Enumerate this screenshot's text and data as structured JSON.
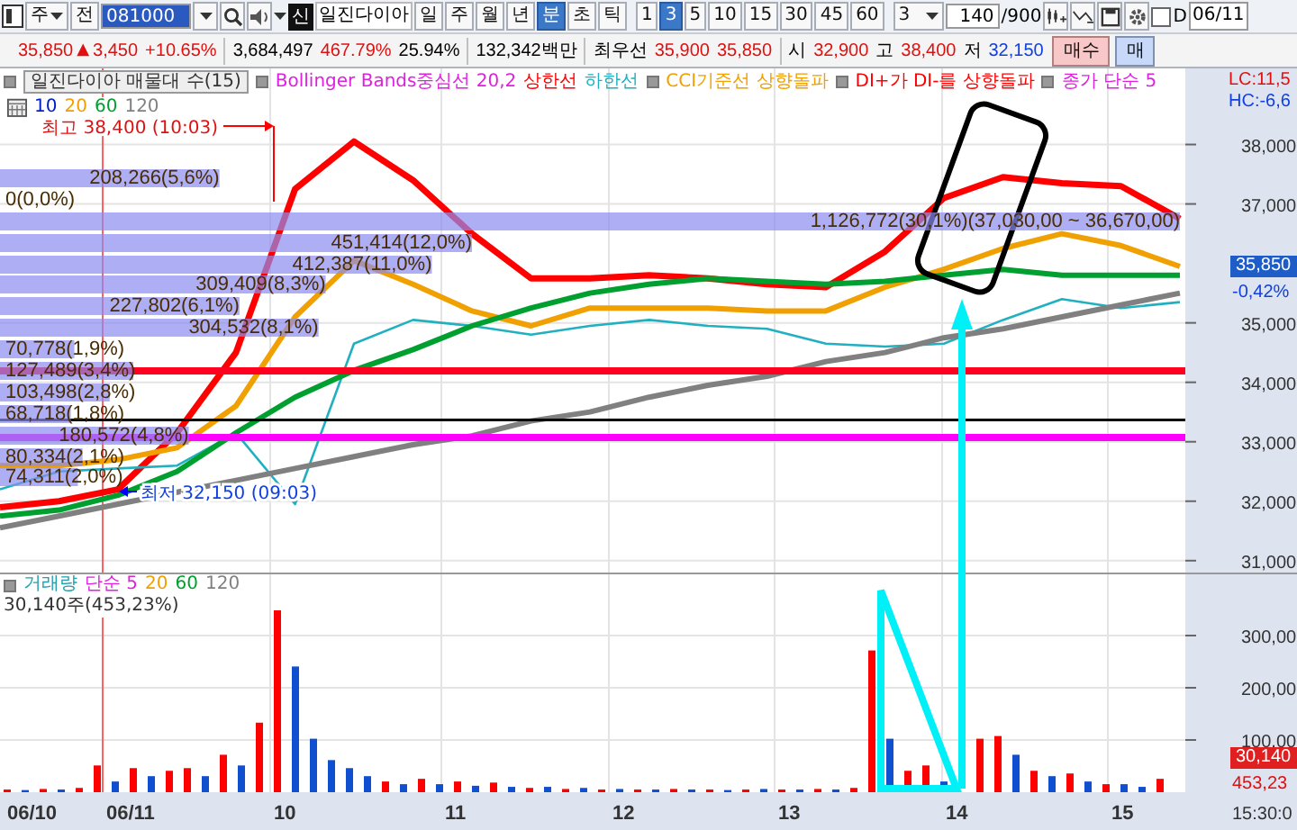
{
  "toolbar": {
    "market": "주",
    "prev": "전",
    "code": "081000",
    "badge": "신",
    "name": "일진다이아",
    "periods": [
      {
        "label": "일",
        "selected": false
      },
      {
        "label": "주",
        "selected": false
      },
      {
        "label": "월",
        "selected": false
      },
      {
        "label": "년",
        "selected": false
      },
      {
        "label": "분",
        "selected": true
      },
      {
        "label": "초",
        "selected": false
      },
      {
        "label": "틱",
        "selected": false
      }
    ],
    "intervals": [
      {
        "label": "1",
        "selected": false
      },
      {
        "label": "3",
        "selected": true
      },
      {
        "label": "5",
        "selected": false
      },
      {
        "label": "10",
        "selected": false
      },
      {
        "label": "15",
        "selected": false
      },
      {
        "label": "30",
        "selected": false
      },
      {
        "label": "45",
        "selected": false
      },
      {
        "label": "60",
        "selected": false
      }
    ],
    "interval_select": "3",
    "count": "140",
    "count_max": "/900",
    "option": {
      "label": "D",
      "checked": false
    },
    "date": "06/11"
  },
  "quote": {
    "price": "35,850",
    "direction": "▲",
    "change": "3,450",
    "change_pct": "+10.65%",
    "volume": "3,684,497",
    "volume_ratio": "467.79%",
    "turnover": "25.94%",
    "amount": "132,342백만",
    "best_label": "최우선",
    "best_ask": "35,900",
    "best_bid": "35,850",
    "open_label": "시",
    "open": "32,900",
    "high_label": "고",
    "high": "38,400",
    "low_label": "저",
    "low": "32,150",
    "buttons": [
      {
        "label": "매수",
        "kind": "buy"
      },
      {
        "label": "매",
        "kind": "sell"
      }
    ]
  },
  "chart": {
    "title": "일진다이아 매물대 수(15)",
    "legend": [
      {
        "label": "Bollinger Bands중심선 20,2",
        "color": "#e020e0",
        "marker": true
      },
      {
        "label": "상한선",
        "color": "#ff0000",
        "marker": false
      },
      {
        "label": "하한선",
        "color": "#20b0c0",
        "marker": false
      },
      {
        "label": "CCI기준선 상향돌파",
        "color": "#f0a000",
        "marker": true
      },
      {
        "label": "DI+가 DI-를 상향돌파",
        "color": "#ff0000",
        "marker": true
      },
      {
        "label": "종가 단순 5",
        "color": "#e020e0",
        "marker": true
      }
    ],
    "ma_legend": [
      {
        "label": "10",
        "color": "#0020c0"
      },
      {
        "label": "20",
        "color": "#f0a000"
      },
      {
        "label": "60",
        "color": "#00a030"
      },
      {
        "label": "120",
        "color": "#808080"
      }
    ],
    "axis": {
      "lc": "LC:11,5",
      "hc": "HC:-6,6",
      "current": "35,850",
      "current_pct": "-0,42%"
    },
    "high_label": "최고 38,400 (10:03)",
    "low_label": "최저 32,150 (09:03)",
    "volume_profile": [
      {
        "label": "208,266(5,6%)",
        "level": 0.186
      },
      {
        "label": "0(0,0%)"
      },
      {
        "label": "1,126,772(30,1%)(37,030,00 ~ 36,670,00)",
        "level": 1
      },
      {
        "label": "451,414(12,0%)",
        "level": 0.4
      },
      {
        "label": "412,387(11,0%)",
        "level": 0.366
      },
      {
        "label": "309,409(8,3%)",
        "level": 0.276
      },
      {
        "label": "227,802(6,1%)",
        "level": 0.203
      },
      {
        "label": "304,532(8,1%)",
        "level": 0.27
      },
      {
        "label": "70,778(1,9%)",
        "level": 0.063
      },
      {
        "label": "127,489(3,4%)",
        "level": 0.113
      },
      {
        "label": "103,498(2,8%)",
        "level": 0.093
      },
      {
        "label": "68,718(1,8%)",
        "level": 0.06
      },
      {
        "label": "180,572(4,8%)",
        "level": 0.16
      },
      {
        "label": "80,334(2,1%)",
        "level": 0.07
      },
      {
        "label": "74,311(2,0%)",
        "level": 0.066
      }
    ],
    "chart_data": {
      "type": "line",
      "categories": [
        null,
        null,
        null,
        null,
        null,
        null,
        null,
        null,
        null,
        null,
        null,
        null,
        null,
        null,
        null,
        null,
        null,
        null,
        null,
        null,
        null
      ],
      "ylim": [
        30800,
        39280
      ],
      "grid": true,
      "yticks": [
        {
          "value": 38000,
          "label": "38,000"
        },
        {
          "value": 37000,
          "label": "37,000"
        },
        {
          "value": 35000,
          "label": "35,000"
        },
        {
          "value": 34000,
          "label": "34,000"
        },
        {
          "value": 33000,
          "label": "33,000"
        },
        {
          "value": 32000,
          "label": "32,000"
        },
        {
          "value": 31000,
          "label": "31,000"
        }
      ],
      "series": [
        {
          "color": "#ff0000",
          "values": [
            31900,
            32000,
            32200,
            33150,
            34500,
            37250,
            38050,
            37400,
            36500,
            35750,
            35750,
            35800,
            35750,
            35650,
            35600,
            36200,
            37100,
            37450,
            37350,
            37300,
            36750
          ]
        },
        {
          "color": "#20b0c0",
          "values": [
            32200,
            32500,
            32550,
            32600,
            33150,
            31950,
            34650,
            35050,
            34950,
            34800,
            34950,
            35050,
            34950,
            34900,
            34650,
            34600,
            34650,
            35050,
            35400,
            35250,
            35350
          ]
        },
        {
          "color": "#f0a000",
          "values": [
            32600,
            32600,
            32700,
            32900,
            33600,
            35100,
            36050,
            35650,
            35200,
            34950,
            35250,
            35250,
            35250,
            35200,
            35200,
            35600,
            35900,
            36250,
            36500,
            36300,
            35950
          ]
        },
        {
          "color": "#00a030",
          "values": [
            31750,
            31850,
            32100,
            32500,
            33150,
            33750,
            34200,
            34550,
            34950,
            35250,
            35500,
            35650,
            35750,
            35700,
            35650,
            35700,
            35800,
            35900,
            35800,
            35800,
            35800
          ]
        },
        {
          "color": "#808080",
          "values": [
            31550,
            31750,
            31950,
            32150,
            32350,
            32550,
            32750,
            32950,
            33100,
            33350,
            33500,
            33750,
            33950,
            34100,
            34350,
            34500,
            34750,
            34900,
            35100,
            35300,
            35500
          ]
        }
      ]
    }
  },
  "volume": {
    "legend": [
      {
        "label": "거래량",
        "color": "#20a0b0",
        "marker": true
      },
      {
        "label": "단순 5",
        "color": "#e020e0",
        "marker": false
      },
      {
        "label": "20",
        "color": "#f0a000",
        "marker": false
      },
      {
        "label": "60",
        "color": "#00a030",
        "marker": false
      },
      {
        "label": "120",
        "color": "#808080",
        "marker": false
      }
    ],
    "summary": "30,140주(453,23%)",
    "axis": {
      "ticks": [
        "300,00",
        "200,00",
        "100,00"
      ],
      "current": "30,140",
      "current_pct": "453,23"
    }
  },
  "time_axis": {
    "labels": [
      "06/10",
      "06/11",
      "10",
      "11",
      "12",
      "13",
      "14",
      "15"
    ],
    "end": "15:30:0"
  }
}
